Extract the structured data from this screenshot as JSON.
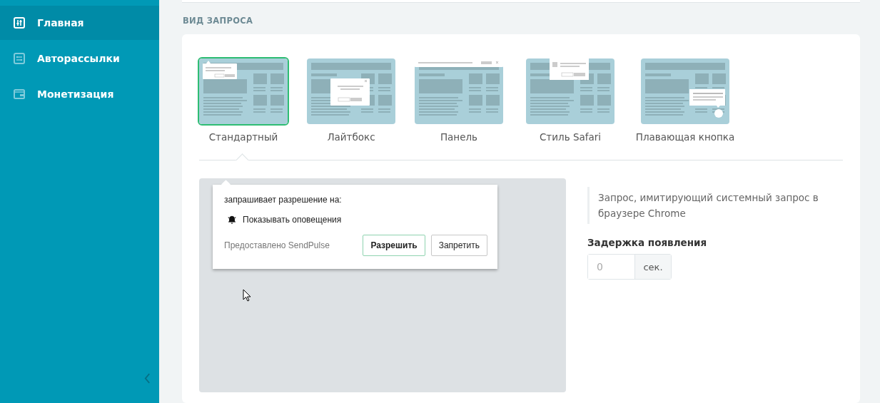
{
  "sidebar": {
    "items": [
      {
        "label": "Главная",
        "kind": "sliders",
        "selected": true
      },
      {
        "label": "Авторассылки",
        "kind": "flow",
        "selected": false
      },
      {
        "label": "Монетизация",
        "kind": "wallet",
        "selected": false
      }
    ]
  },
  "section_title": "ВИД ЗАПРОСА",
  "request_types": [
    {
      "label": "Стандартный",
      "kind": "standard",
      "selected": true
    },
    {
      "label": "Лайтбокс",
      "kind": "lightbox",
      "selected": false
    },
    {
      "label": "Панель",
      "kind": "panel",
      "selected": false
    },
    {
      "label": "Стиль Safari",
      "kind": "safari",
      "selected": false
    },
    {
      "label": "Плавающая кнопка",
      "kind": "floating",
      "selected": false
    }
  ],
  "preview": {
    "prompt": "запрашивает разрешение на:",
    "permission": "Показывать оповещения",
    "provider": "Предоставлено SendPulse",
    "allow_button": "Разрешить",
    "deny_button": "Запретить"
  },
  "description": "Запрос, имитирующий системный запрос в браузере Chrome",
  "delay": {
    "label": "Задержка появления",
    "placeholder": "0",
    "unit": "сек."
  }
}
